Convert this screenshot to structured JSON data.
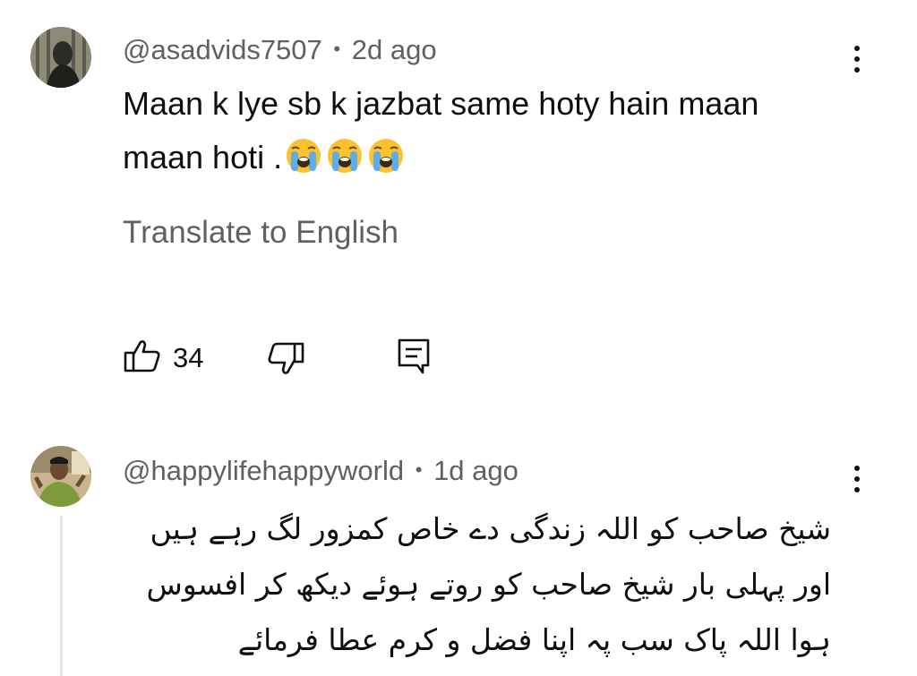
{
  "comments": [
    {
      "author": "@asadvids7507",
      "separator": "•",
      "time": "2d ago",
      "text": "Maan k lye sb k jazbat same hoty hain maan maan hoti .",
      "emoji": "loudly-crying-face",
      "emoji_count": 3,
      "translate": "Translate to English",
      "likes": "34",
      "icons": {
        "like": "thumbs-up-icon",
        "dislike": "thumbs-down-icon",
        "reply": "reply-comment-icon",
        "menu": "more-vert-icon"
      }
    },
    {
      "author": "@happylifehappyworld",
      "separator": "•",
      "time": "1d ago",
      "text_lines": [
        "شیخ صاحب کو اللہ زندگی دے خاص کمزور لگ رہے ہیں",
        "اور پہلی بار شیخ صاحب کو روتے ہوئے دیکھ کر افسوس",
        "ہوا اللہ پاک سب پہ اپنا فضل و کرم عطا فرمائے"
      ],
      "icons": {
        "menu": "more-vert-icon"
      }
    }
  ],
  "colors": {
    "primary_text": "#0f0f0f",
    "secondary_text": "#606060",
    "thread_line": "#e5e5e5",
    "emoji_yellow": "#f9c22e",
    "emoji_tears": "#5dadec"
  }
}
